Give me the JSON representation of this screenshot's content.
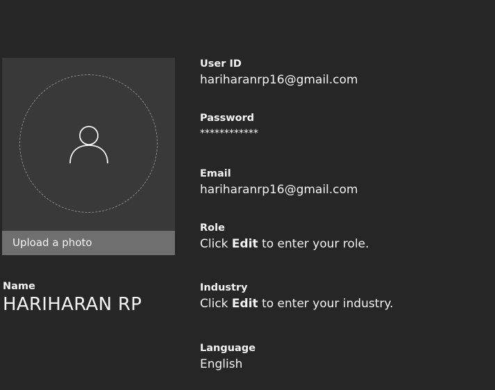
{
  "photo": {
    "upload_label": "Upload a photo",
    "icon": "user-icon"
  },
  "name": {
    "label": "Name",
    "value": "HARIHARAN RP"
  },
  "fields": {
    "user_id": {
      "label": "User ID",
      "value": "hariharanrp16@gmail.com"
    },
    "password": {
      "label": "Password",
      "value": "************"
    },
    "email": {
      "label": "Email",
      "value": "hariharanrp16@gmail.com"
    },
    "role": {
      "label": "Role",
      "prefix": "Click ",
      "action": "Edit",
      "suffix": " to enter your role."
    },
    "industry": {
      "label": "Industry",
      "prefix": "Click ",
      "action": "Edit",
      "suffix": " to enter your industry."
    },
    "language": {
      "label": "Language",
      "value": "English"
    }
  },
  "colors": {
    "background": "#262626",
    "panel": "#393939",
    "upload_bar": "#6f6f6f",
    "text": "#f4f4f4"
  }
}
